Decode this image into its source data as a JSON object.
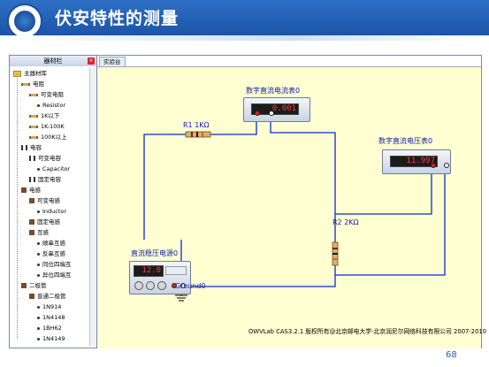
{
  "slide": {
    "title": "伏安特性的测量",
    "page_number": "68"
  },
  "colors": {
    "header": "#1a55a8",
    "canvas_bg": "#ffffd2",
    "wire": "#0a2bcc",
    "label": "#0b1ea8"
  },
  "left_panel": {
    "title": "器材栏",
    "tree": [
      {
        "label": "主器材库",
        "level": 0,
        "icon": "folder-icon"
      },
      {
        "label": "电阻",
        "level": 1,
        "icon": "resistor-icon"
      },
      {
        "label": "可变电阻",
        "level": 2,
        "icon": "resistor-icon"
      },
      {
        "label": "Resistor",
        "level": 3,
        "icon": "dot-icon"
      },
      {
        "label": "1K以下",
        "level": 2,
        "icon": "resistor-icon"
      },
      {
        "label": "1K-100K",
        "level": 2,
        "icon": "resistor-icon"
      },
      {
        "label": "100K以上",
        "level": 2,
        "icon": "resistor-icon"
      },
      {
        "label": "电容",
        "level": 1,
        "icon": "capacitor-icon"
      },
      {
        "label": "可变电容",
        "level": 2,
        "icon": "capacitor-icon"
      },
      {
        "label": "Capacitor",
        "level": 3,
        "icon": "dot-icon"
      },
      {
        "label": "固定电容",
        "level": 2,
        "icon": "capacitor-icon"
      },
      {
        "label": "电感",
        "level": 1,
        "icon": "inductor-icon"
      },
      {
        "label": "可变电感",
        "level": 2,
        "icon": "inductor-icon"
      },
      {
        "label": "Inductor",
        "level": 3,
        "icon": "dot-icon"
      },
      {
        "label": "固定电感",
        "level": 2,
        "icon": "inductor-icon"
      },
      {
        "label": "互感",
        "level": 2,
        "icon": "inductor-icon"
      },
      {
        "label": "顺串互感",
        "level": 3,
        "icon": "dot-icon"
      },
      {
        "label": "反串互感",
        "level": 3,
        "icon": "dot-icon"
      },
      {
        "label": "同位四端互",
        "level": 3,
        "icon": "dot-icon"
      },
      {
        "label": "异位四端互",
        "level": 3,
        "icon": "dot-icon"
      },
      {
        "label": "二极管",
        "level": 1,
        "icon": "diode-icon"
      },
      {
        "label": "普通二极管",
        "level": 2,
        "icon": "diode-icon"
      },
      {
        "label": "1N914",
        "level": 3,
        "icon": "dot-icon"
      },
      {
        "label": "1N4148",
        "level": 3,
        "icon": "dot-icon"
      },
      {
        "label": "1BH62",
        "level": 3,
        "icon": "dot-icon"
      },
      {
        "label": "1N4149",
        "level": 3,
        "icon": "dot-icon"
      }
    ]
  },
  "workspace": {
    "tab_label": "实验台",
    "components": {
      "ammeter": {
        "label": "数字直流电流表0",
        "display": "0.001"
      },
      "voltmeter": {
        "label": "数字直流电压表0",
        "display": "11.997"
      },
      "power_supply": {
        "label": "直流稳压电源0",
        "display": "12.0"
      },
      "r1": {
        "label": "R1 1KΩ"
      },
      "r2": {
        "label": "R2 2KΩ"
      },
      "ground": {
        "label": "Ground0"
      }
    },
    "footer": "OWVLab CAS3.2.1 版权所有@北京邮电大学-北京润尼尔网络科技有限公司 2007-2010"
  }
}
